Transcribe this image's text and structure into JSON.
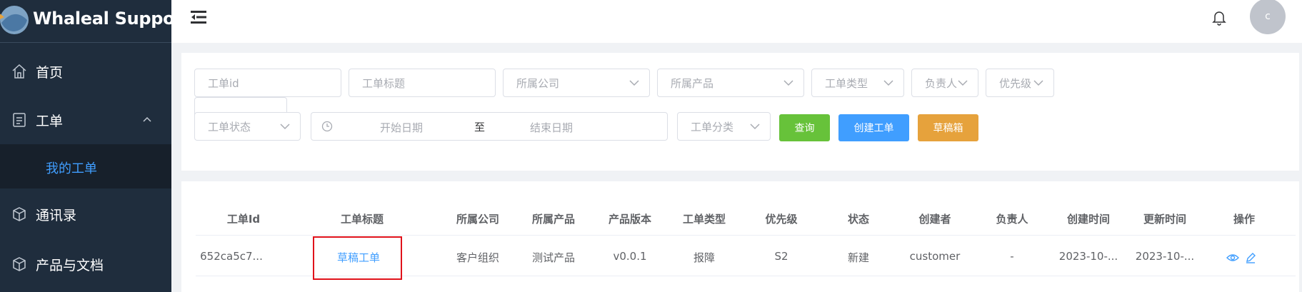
{
  "app": {
    "title": "Whaleal Support"
  },
  "sidebar": {
    "items": [
      {
        "label": "首页",
        "icon": "home-icon"
      },
      {
        "label": "工单",
        "icon": "ticket-icon",
        "expanded": true
      },
      {
        "label": "我的工单",
        "active": true
      },
      {
        "label": "通讯录",
        "icon": "cube-icon"
      },
      {
        "label": "产品与文档",
        "icon": "cube-icon"
      }
    ]
  },
  "header": {
    "avatar_letter": "c"
  },
  "filters": {
    "ticket_id": "工单id",
    "ticket_title": "工单标题",
    "company": "所属公司",
    "product": "所属产品",
    "ticket_type": "工单类型",
    "assignee": "负责人",
    "priority": "优先级",
    "status": "工单状态",
    "start_date": "开始日期",
    "range_separator": "至",
    "end_date": "结束日期",
    "category": "工单分类"
  },
  "buttons": {
    "search": "查询",
    "create": "创建工单",
    "drafts": "草稿箱"
  },
  "colors": {
    "accent": "#409eff",
    "search_button": "#67c23a",
    "create_button": "#409eff",
    "drafts_button": "#e6a23c",
    "sidebar_bg": "#1f2d3d",
    "highlight": "#e0121b"
  },
  "table": {
    "columns": [
      "工单Id",
      "工单标题",
      "所属公司",
      "所属产品",
      "产品版本",
      "工单类型",
      "优先级",
      "状态",
      "创建者",
      "负责人",
      "创建时间",
      "更新时间",
      "操作"
    ],
    "rows": [
      {
        "id": "652ca5c7...",
        "title": "草稿工单",
        "company": "客户组织",
        "product": "测试产品",
        "version": "v0.0.1",
        "type": "报障",
        "priority": "S2",
        "status": "新建",
        "creator": "customer",
        "assignee": "-",
        "created": "2023-10-...",
        "updated": "2023-10-...",
        "actions": [
          "view-icon",
          "edit-icon"
        ]
      }
    ]
  }
}
